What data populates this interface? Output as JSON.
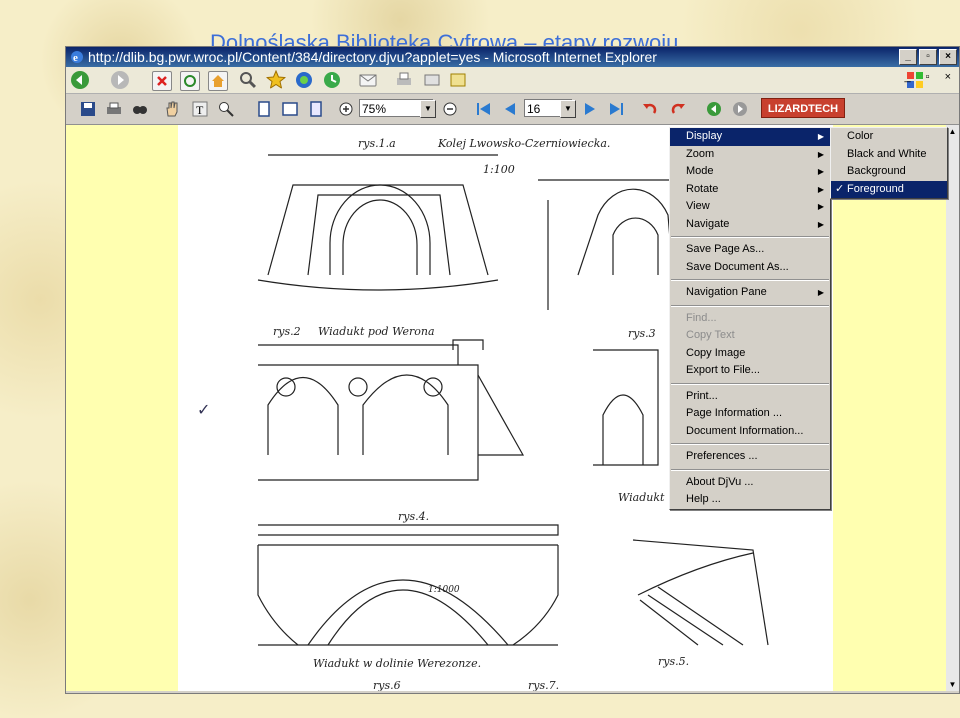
{
  "slide": {
    "title": "Dolnośląska Biblioteka Cyfrowa – etapy rozwoju"
  },
  "window": {
    "title": "http://dlib.bg.pwr.wroc.pl/Content/384/directory.djvu?applet=yes - Microsoft Internet Explorer"
  },
  "toolbar": {
    "zoom_value": "75%",
    "page_value": "16",
    "brand_label": "LIZARDTECH"
  },
  "context_menu": {
    "items": [
      {
        "label": "Display",
        "submenu": true,
        "selected": true
      },
      {
        "label": "Zoom",
        "submenu": true
      },
      {
        "label": "Mode",
        "submenu": true
      },
      {
        "label": "Rotate",
        "submenu": true
      },
      {
        "label": "View",
        "submenu": true
      },
      {
        "label": "Navigate",
        "submenu": true
      },
      {
        "label": "Save Page As..."
      },
      {
        "label": "Save Document As..."
      },
      {
        "label": "Navigation Pane",
        "submenu": true
      },
      {
        "label": "Find...",
        "disabled": true
      },
      {
        "label": "Copy Text",
        "disabled": true
      },
      {
        "label": "Copy Image"
      },
      {
        "label": "Export to File..."
      },
      {
        "label": "Print..."
      },
      {
        "label": "Page Information ..."
      },
      {
        "label": "Document Information..."
      },
      {
        "label": "Preferences ..."
      },
      {
        "label": "About DjVu ..."
      },
      {
        "label": "Help ..."
      }
    ]
  },
  "display_submenu": {
    "items": [
      {
        "label": "Color"
      },
      {
        "label": "Black and White"
      },
      {
        "label": "Background"
      },
      {
        "label": "Foreground",
        "checked": true,
        "selected": true
      }
    ]
  },
  "drawing": {
    "labels": {
      "rys1": "rys.1.a",
      "line": "Kolej Lwowsko-Czerniowiecka.",
      "scale1": "1:100",
      "rys2": "rys.2",
      "wiadukt1": "Wiadukt pod Werona",
      "rys3": "rys.3",
      "rys4": "rys.4.",
      "wiadukt2": "Wiadukt w dolinie Werezonze.",
      "wiadukt3": "Wiadukt",
      "rys5": "rys.5.",
      "rys6": "rys.6",
      "rys7": "rys.7.",
      "scale2": "1:1000"
    }
  },
  "colors": {
    "menu_bg": "#d4d0c8",
    "highlight": "#0a246a",
    "content_bg": "#ffffb0"
  }
}
